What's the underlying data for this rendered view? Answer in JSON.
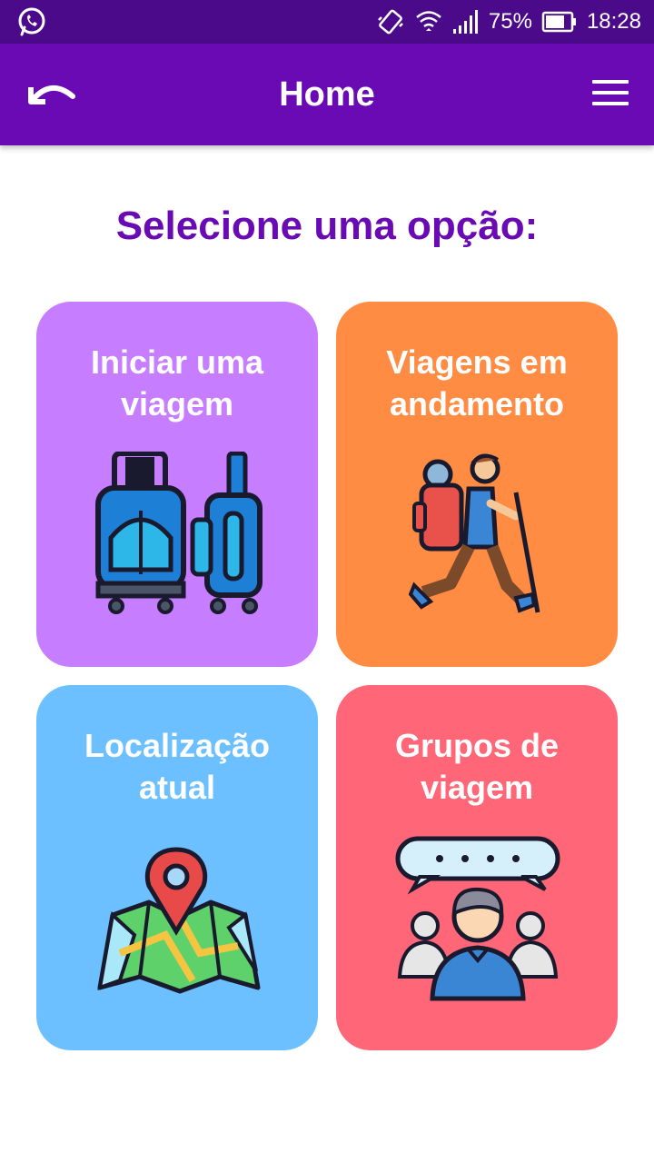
{
  "status_bar": {
    "battery_percent": "75%",
    "time": "18:28",
    "icons": [
      "whatsapp-icon",
      "vibrate-icon",
      "wifi-icon",
      "signal-icon",
      "battery-icon"
    ]
  },
  "app_bar": {
    "title": "Home",
    "back_icon": "undo-arrow-icon",
    "menu_icon": "hamburger-menu-icon"
  },
  "heading": "Selecione uma opção:",
  "cards": [
    {
      "line1": "Iniciar uma",
      "line2": "viagem",
      "color": "#c77dff",
      "icon": "suitcases-icon"
    },
    {
      "line1": "Viagens em",
      "line2": "andamento",
      "color": "#ff8c42",
      "icon": "hiker-icon"
    },
    {
      "line1": "Localização",
      "line2": "atual",
      "color": "#6cc0ff",
      "icon": "map-pin-icon"
    },
    {
      "line1": "Grupos de",
      "line2": "viagem",
      "color": "#ff6678",
      "icon": "group-chat-icon"
    }
  ],
  "colors": {
    "status_bar": "#4a0a8a",
    "app_bar": "#6a0ab5",
    "heading": "#6a0ab5"
  }
}
